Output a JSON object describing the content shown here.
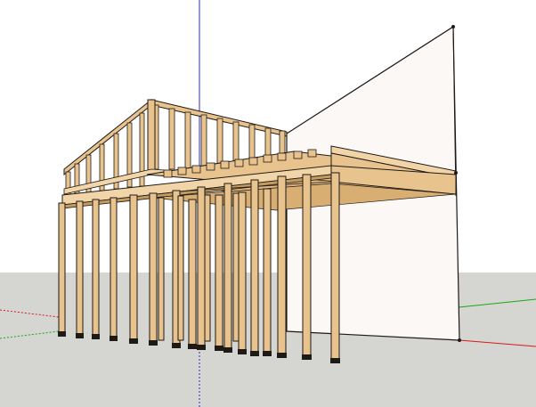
{
  "app": {
    "type": "3d-modeling-viewport"
  },
  "colors": {
    "sky": "#ffffff",
    "ground": "#d5d5d1",
    "wall_face": "#fbf8f6",
    "wood": "#e9c38e",
    "wood_light": "#f1d5a8",
    "wood_dark": "#c49a5e",
    "edge": "#1e1a16",
    "axis_blue": "#2a2ad8",
    "axis_green": "#18a818",
    "axis_red": "#d81a1a"
  },
  "scene": {
    "objects": [
      "ground-plane",
      "vertical-wall-panel",
      "timber-frame-structure",
      "floor-joists",
      "beams",
      "posts"
    ],
    "axes": [
      "blue-axis",
      "green-axis",
      "red-axis"
    ]
  }
}
